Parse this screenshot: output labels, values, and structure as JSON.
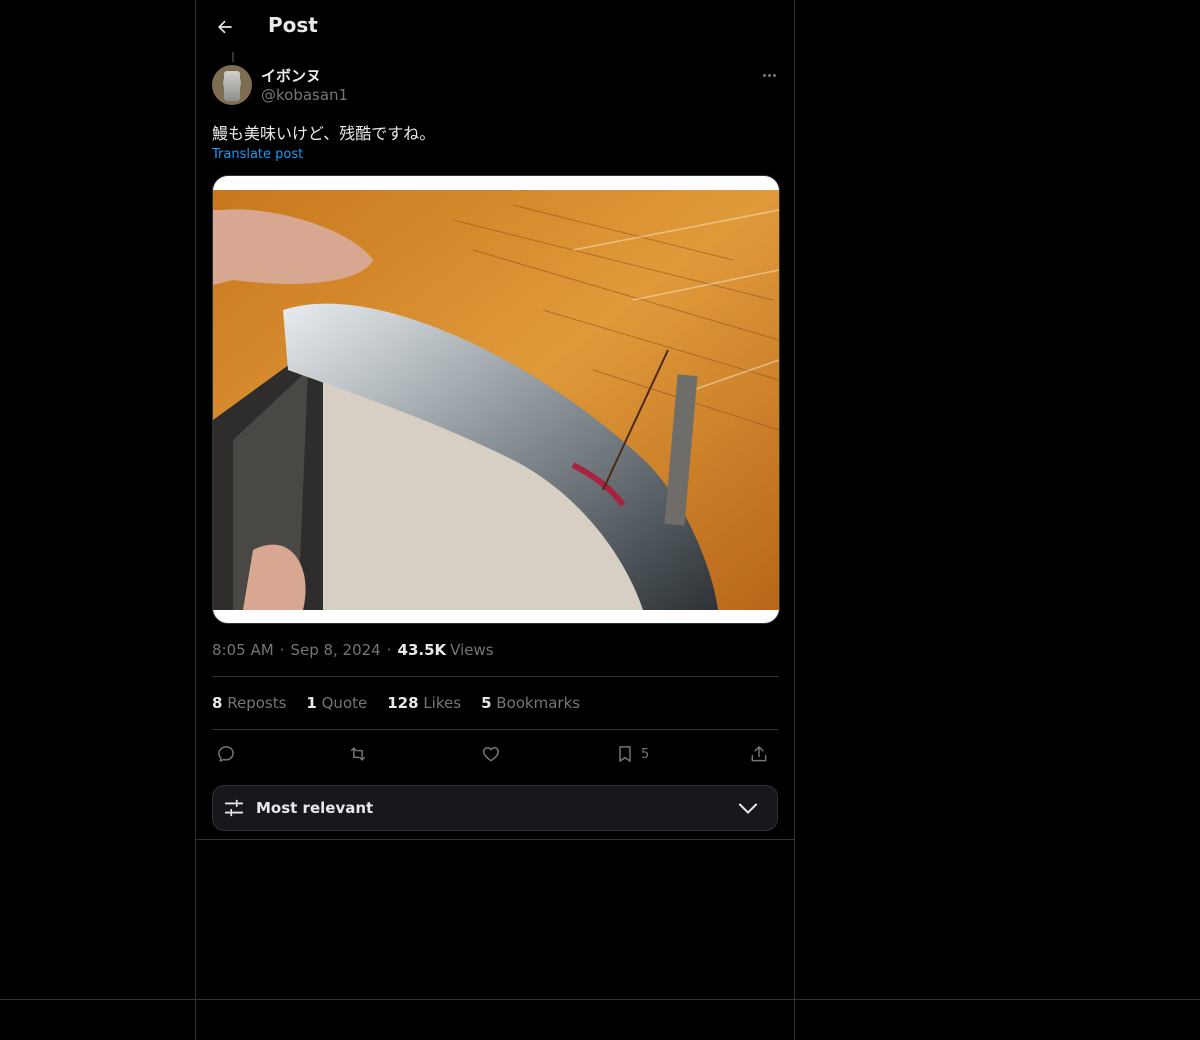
{
  "header": {
    "title": "Post",
    "back_icon": "arrow-left-icon"
  },
  "author": {
    "name": "イボンヌ",
    "handle": "@kobasan1"
  },
  "post": {
    "text": "鰻も美味いけど、残酷ですね。",
    "translate_label": "Translate post",
    "time": "8:05 AM",
    "date": "Sep 8, 2024",
    "separator": "·",
    "views_count": "43.5K",
    "views_label": "Views"
  },
  "stats": [
    {
      "count": "8",
      "label": "Reposts"
    },
    {
      "count": "1",
      "label": "Quote"
    },
    {
      "count": "128",
      "label": "Likes"
    },
    {
      "count": "5",
      "label": "Bookmarks"
    }
  ],
  "actions": {
    "reply_icon": "reply-icon",
    "repost_icon": "repost-icon",
    "like_icon": "heart-icon",
    "bookmark_icon": "bookmark-icon",
    "bookmark_count": "5",
    "share_icon": "share-icon"
  },
  "sort": {
    "label": "Most relevant",
    "icon": "sliders-icon",
    "chevron": "chevron-down-icon"
  },
  "colors": {
    "background": "#000000",
    "border": "#2f3336",
    "text_primary": "#e7e9ea",
    "text_secondary": "#71767b",
    "link": "#1d9bf0"
  }
}
